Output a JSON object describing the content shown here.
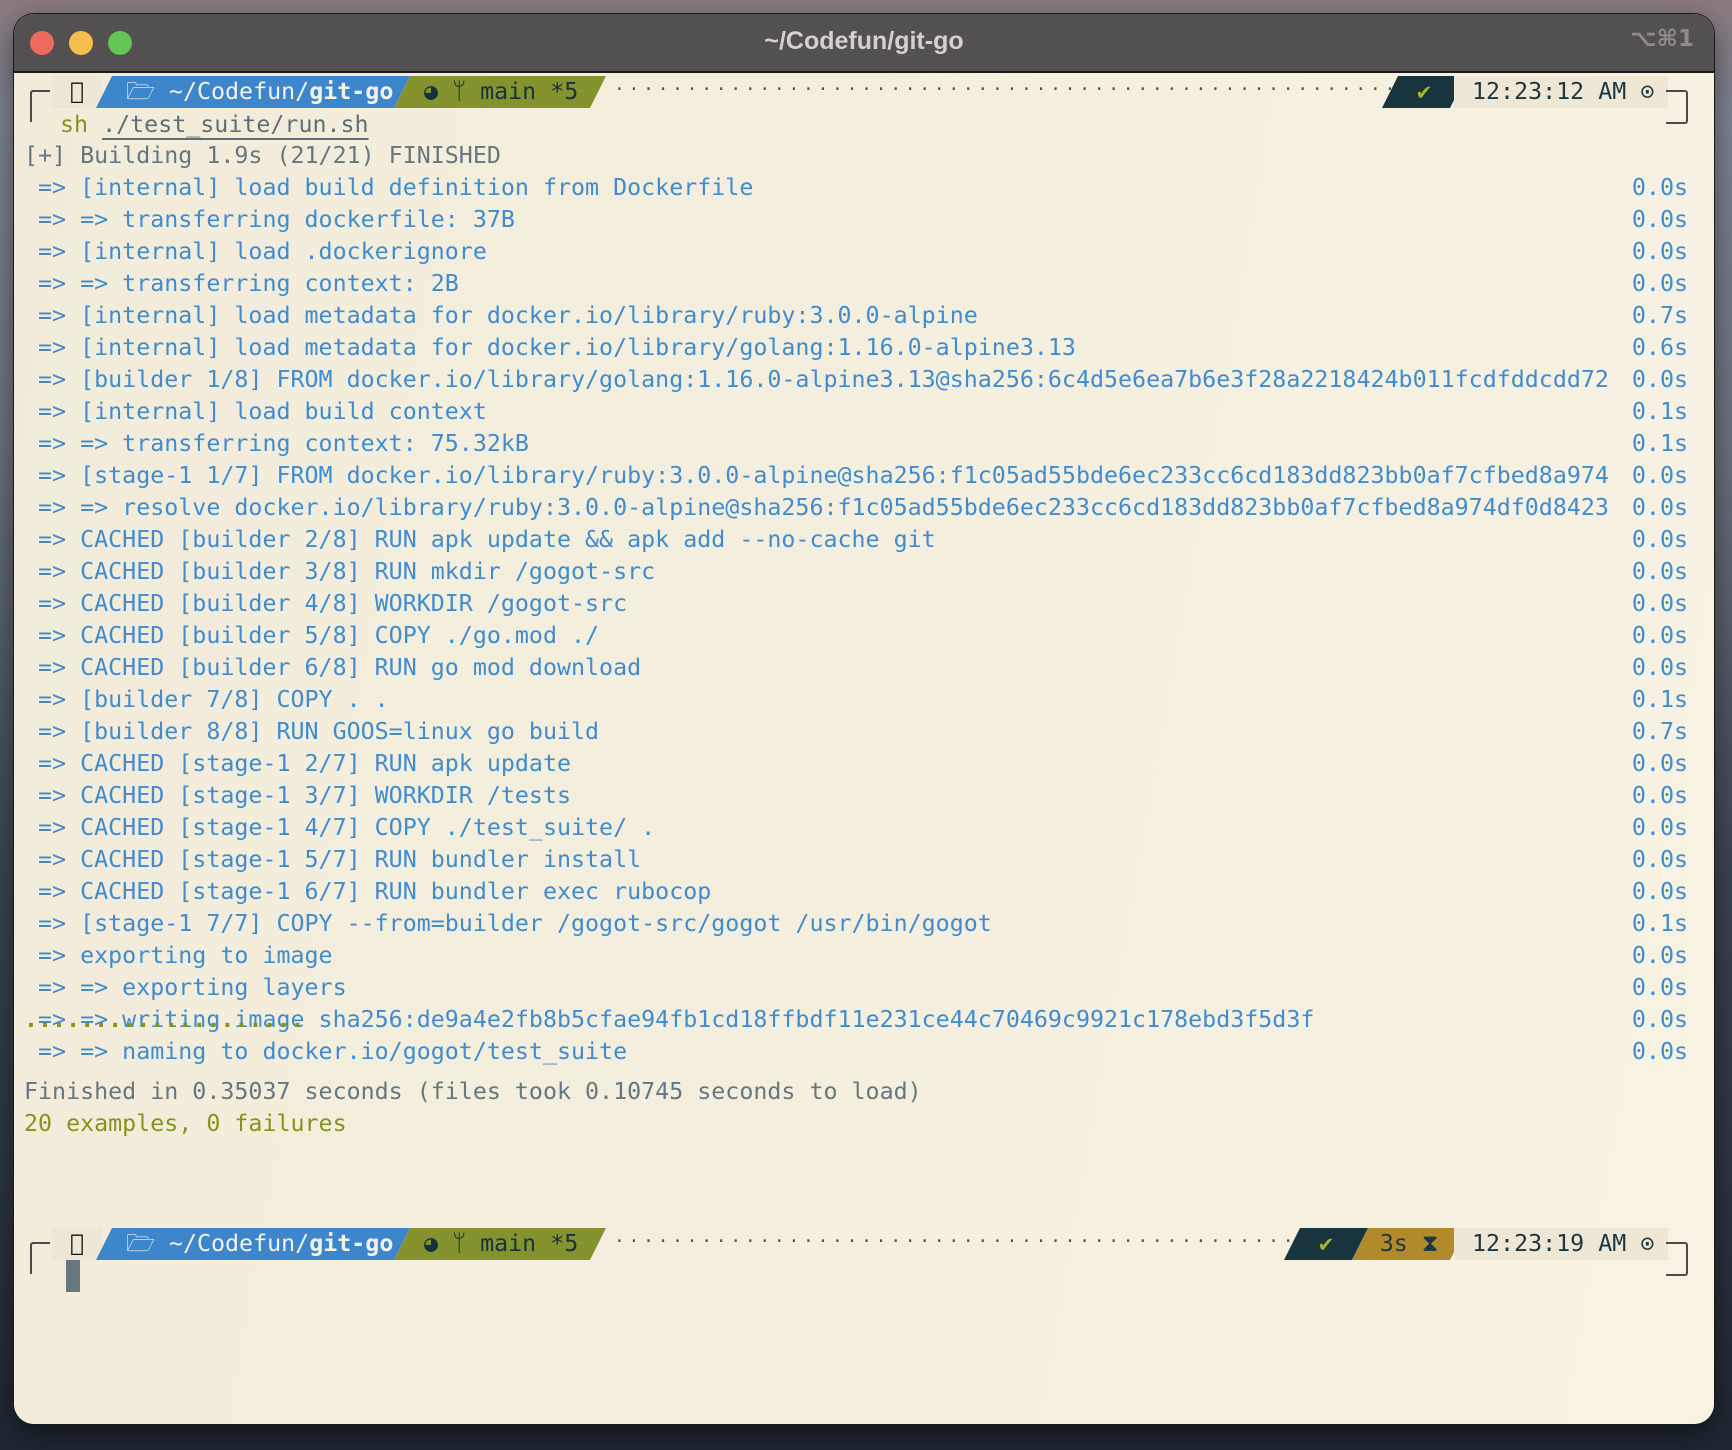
{
  "window": {
    "title": "~/Codefun/git-go",
    "shortcut": "⌥⌘1"
  },
  "colors": {
    "output_blue": "#3f8ccf",
    "prompt_dir_bg": "#3d86cc",
    "prompt_git_bg": "#84932d",
    "status_bg": "#17343f",
    "duration_bg": "#b18a2c",
    "success_green": "#83941f",
    "background": "#f6f0e0"
  },
  "prompt_top": {
    "os_icon": "apple-icon",
    "dir_prefix": "~/Codefun/",
    "dir_bold": "git-go",
    "git_branch": "main *5",
    "status": "✔",
    "clock": "12:23:12 AM",
    "command_sh": "sh",
    "command_path": "./test_suite/run.sh"
  },
  "build_header": "[+] Building 1.9s (21/21) FINISHED",
  "build_lines": [
    {
      "text": " => [internal] load build definition from Dockerfile",
      "time": "0.0s"
    },
    {
      "text": " => => transferring dockerfile: 37B",
      "time": "0.0s"
    },
    {
      "text": " => [internal] load .dockerignore",
      "time": "0.0s"
    },
    {
      "text": " => => transferring context: 2B",
      "time": "0.0s"
    },
    {
      "text": " => [internal] load metadata for docker.io/library/ruby:3.0.0-alpine",
      "time": "0.7s"
    },
    {
      "text": " => [internal] load metadata for docker.io/library/golang:1.16.0-alpine3.13",
      "time": "0.6s"
    },
    {
      "text": " => [builder 1/8] FROM docker.io/library/golang:1.16.0-alpine3.13@sha256:6c4d5e6ea7b6e3f28a2218424b011fcdfddcdd72",
      "time": "0.0s"
    },
    {
      "text": " => [internal] load build context",
      "time": "0.1s"
    },
    {
      "text": " => => transferring context: 75.32kB",
      "time": "0.1s"
    },
    {
      "text": " => [stage-1 1/7] FROM docker.io/library/ruby:3.0.0-alpine@sha256:f1c05ad55bde6ec233cc6cd183dd823bb0af7cfbed8a974",
      "time": "0.0s"
    },
    {
      "text": " => => resolve docker.io/library/ruby:3.0.0-alpine@sha256:f1c05ad55bde6ec233cc6cd183dd823bb0af7cfbed8a974df0d8423",
      "time": "0.0s"
    },
    {
      "text": " => CACHED [builder 2/8] RUN apk update && apk add --no-cache git",
      "time": "0.0s"
    },
    {
      "text": " => CACHED [builder 3/8] RUN mkdir /gogot-src",
      "time": "0.0s"
    },
    {
      "text": " => CACHED [builder 4/8] WORKDIR /gogot-src",
      "time": "0.0s"
    },
    {
      "text": " => CACHED [builder 5/8] COPY ./go.mod ./",
      "time": "0.0s"
    },
    {
      "text": " => CACHED [builder 6/8] RUN go mod download",
      "time": "0.0s"
    },
    {
      "text": " => [builder 7/8] COPY . .",
      "time": "0.1s"
    },
    {
      "text": " => [builder 8/8] RUN GOOS=linux go build",
      "time": "0.7s"
    },
    {
      "text": " => CACHED [stage-1 2/7] RUN apk update",
      "time": "0.0s"
    },
    {
      "text": " => CACHED [stage-1 3/7] WORKDIR /tests",
      "time": "0.0s"
    },
    {
      "text": " => CACHED [stage-1 4/7] COPY ./test_suite/ .",
      "time": "0.0s"
    },
    {
      "text": " => CACHED [stage-1 5/7] RUN bundler install",
      "time": "0.0s"
    },
    {
      "text": " => CACHED [stage-1 6/7] RUN bundler exec rubocop",
      "time": "0.0s"
    },
    {
      "text": " => [stage-1 7/7] COPY --from=builder /gogot-src/gogot /usr/bin/gogot",
      "time": "0.1s"
    },
    {
      "text": " => exporting to image",
      "time": "0.0s"
    },
    {
      "text": " => => exporting layers",
      "time": "0.0s"
    },
    {
      "text": " => => writing image sha256:de9a4e2fb8b5cfae94fb1cd18ffbdf11e231ce44c70469c9921c178ebd3f5d3f",
      "time": "0.0s"
    },
    {
      "text": " => => naming to docker.io/gogot/test_suite",
      "time": "0.0s"
    }
  ],
  "test_progress": "....................",
  "finished_line": "Finished in 0.35037 seconds (files took 0.10745 seconds to load)",
  "summary_line": "20 examples, 0 failures",
  "prompt_bottom": {
    "os_icon": "apple-icon",
    "dir_prefix": "~/Codefun/",
    "dir_bold": "git-go",
    "git_branch": "main *5",
    "status": "✔",
    "duration": "3s",
    "clock": "12:23:19 AM"
  }
}
